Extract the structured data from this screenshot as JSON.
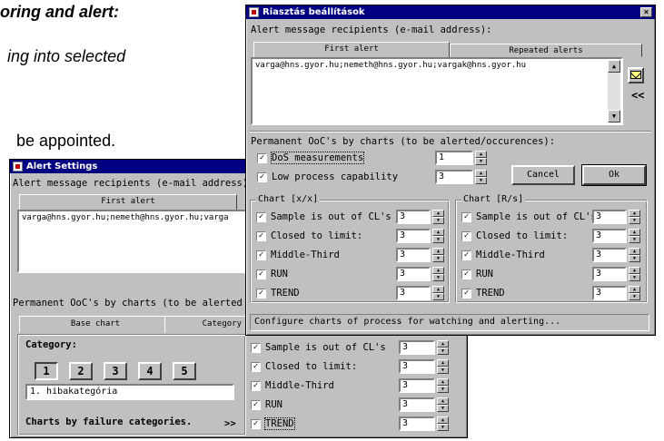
{
  "document": {
    "line1": "oring and alert:",
    "line2": "ing  into  selected",
    "line3": "be appointed."
  },
  "back_window": {
    "title": "Alert Settings",
    "recipients_label": "Alert message recipients (e-mail address):",
    "tab_first": "First alert",
    "recipients_text": "varga@hns.gyor.hu;nemeth@hns.gyor.hu;varga",
    "permanent_label": "Permanent OoC's by charts (to be alerted",
    "tab_base_chart": "Base chart",
    "tab_category": "Category",
    "category_label": "Category:",
    "category_tabs": [
      "1",
      "2",
      "3",
      "4",
      "5"
    ],
    "category_value": "1. hibakategória",
    "failure_label": "Charts by failure categories.",
    "failure_arrow": ">>",
    "rows": [
      {
        "label": "Sample is out of CL's",
        "value": "3",
        "checked": true
      },
      {
        "label": "Closed to limit:",
        "value": "3",
        "checked": true
      },
      {
        "label": "Middle-Third",
        "value": "3",
        "checked": true
      },
      {
        "label": "RUN",
        "value": "3",
        "checked": true
      },
      {
        "label": "TREND",
        "value": "3",
        "checked": true
      }
    ]
  },
  "front_window": {
    "title": "Riasztás beállítások",
    "close_glyph": "×",
    "recipients_label": "Alert message recipients (e-mail address):",
    "tab_first": "First alert",
    "tab_repeated": "Repeated alerts",
    "recipients_text": "varga@hns.gyor.hu;nemeth@hns.gyor.hu;vargak@hns.gyor.hu",
    "side_arrow": "<<",
    "permanent_label": "Permanent OoC's by charts (to be alerted/occurences):",
    "dos_label": "DoS measurements",
    "dos_value": "1",
    "low_label": "Low process capability",
    "low_value": "3",
    "cancel_label": "Cancel",
    "ok_label": "Ok",
    "group_left_title": "Chart [x/x]",
    "group_right_title": "Chart [R/s]",
    "left_rows": [
      {
        "label": "Sample is out of CL's",
        "value": "3",
        "checked": true
      },
      {
        "label": "Closed to limit:",
        "value": "3",
        "checked": true
      },
      {
        "label": "Middle-Third",
        "value": "3",
        "checked": true
      },
      {
        "label": "RUN",
        "value": "3",
        "checked": true
      },
      {
        "label": "TREND",
        "value": "3",
        "checked": true
      }
    ],
    "right_rows": [
      {
        "label": "Sample is out of CL's",
        "value": "3",
        "checked": true
      },
      {
        "label": "Closed to limit:",
        "value": "3",
        "checked": true
      },
      {
        "label": "Middle-Third",
        "value": "3",
        "checked": true
      },
      {
        "label": "RUN",
        "value": "3",
        "checked": true
      },
      {
        "label": "TREND",
        "value": "3",
        "checked": true
      }
    ],
    "status_text": "Configure charts of process for watching and alerting..."
  },
  "check_glyph": "✓"
}
